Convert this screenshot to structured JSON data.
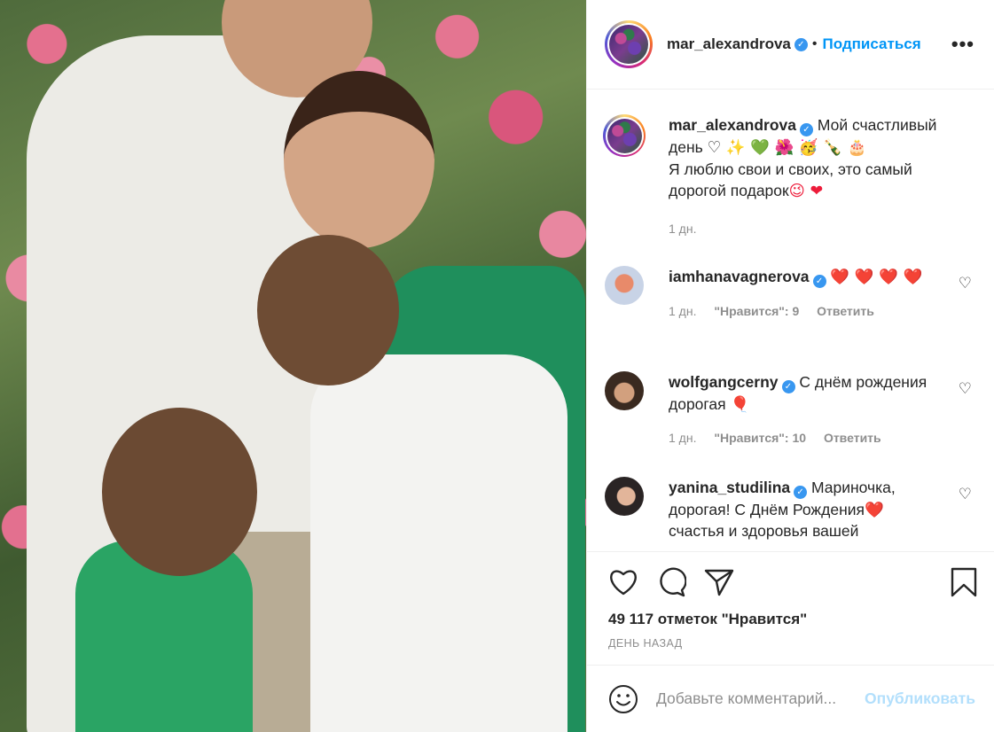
{
  "header": {
    "username": "mar_alexandrova",
    "dot": "•",
    "follow_label": "Подписаться",
    "more_label": "•••"
  },
  "caption": {
    "username": "mar_alexandrova",
    "line1": "Мой счастливый день",
    "emojis": "♡ ✨ 💚 🌺 🥳 🍾 🎂",
    "line2": "Я люблю свои и своих, это самый дорогой подарок",
    "line2_emojis": "😉 ❤",
    "time": "1 дн."
  },
  "comments": [
    {
      "username": "iamhanavagnerova",
      "text": "❤️ ❤️ ❤️ ❤️",
      "time": "1 дн.",
      "likes": "\"Нравится\": 9",
      "reply": "Ответить"
    },
    {
      "username": "wolfgangcerny",
      "text": "С днём рождения дорогая 🎈",
      "time": "1 дн.",
      "likes": "\"Нравится\": 10",
      "reply": "Ответить"
    },
    {
      "username": "yanina_studilina",
      "text": "Мариночка, дорогая! С Днём Рождения❤️ счастья и здоровья вашей",
      "time": "",
      "likes": "",
      "reply": ""
    }
  ],
  "actions": {
    "likes_count": "49 117 отметок \"Нравится\"",
    "time_ago": "ДЕНЬ НАЗАД"
  },
  "add_comment": {
    "placeholder": "Добавьте комментарий...",
    "publish_label": "Опубликовать"
  },
  "icons": {
    "like": "heart-icon",
    "comment": "comment-icon",
    "share": "share-icon",
    "save": "bookmark-icon",
    "emoji": "smile-icon",
    "verified": "verified-badge-icon",
    "more": "more-options-icon"
  },
  "colors": {
    "link_blue": "#0095f6",
    "publish_disabled": "#b2dffc",
    "verified": "#3897f0",
    "heart_red": "#ed1c3a",
    "text": "#262626",
    "muted": "#8e8e8e"
  }
}
